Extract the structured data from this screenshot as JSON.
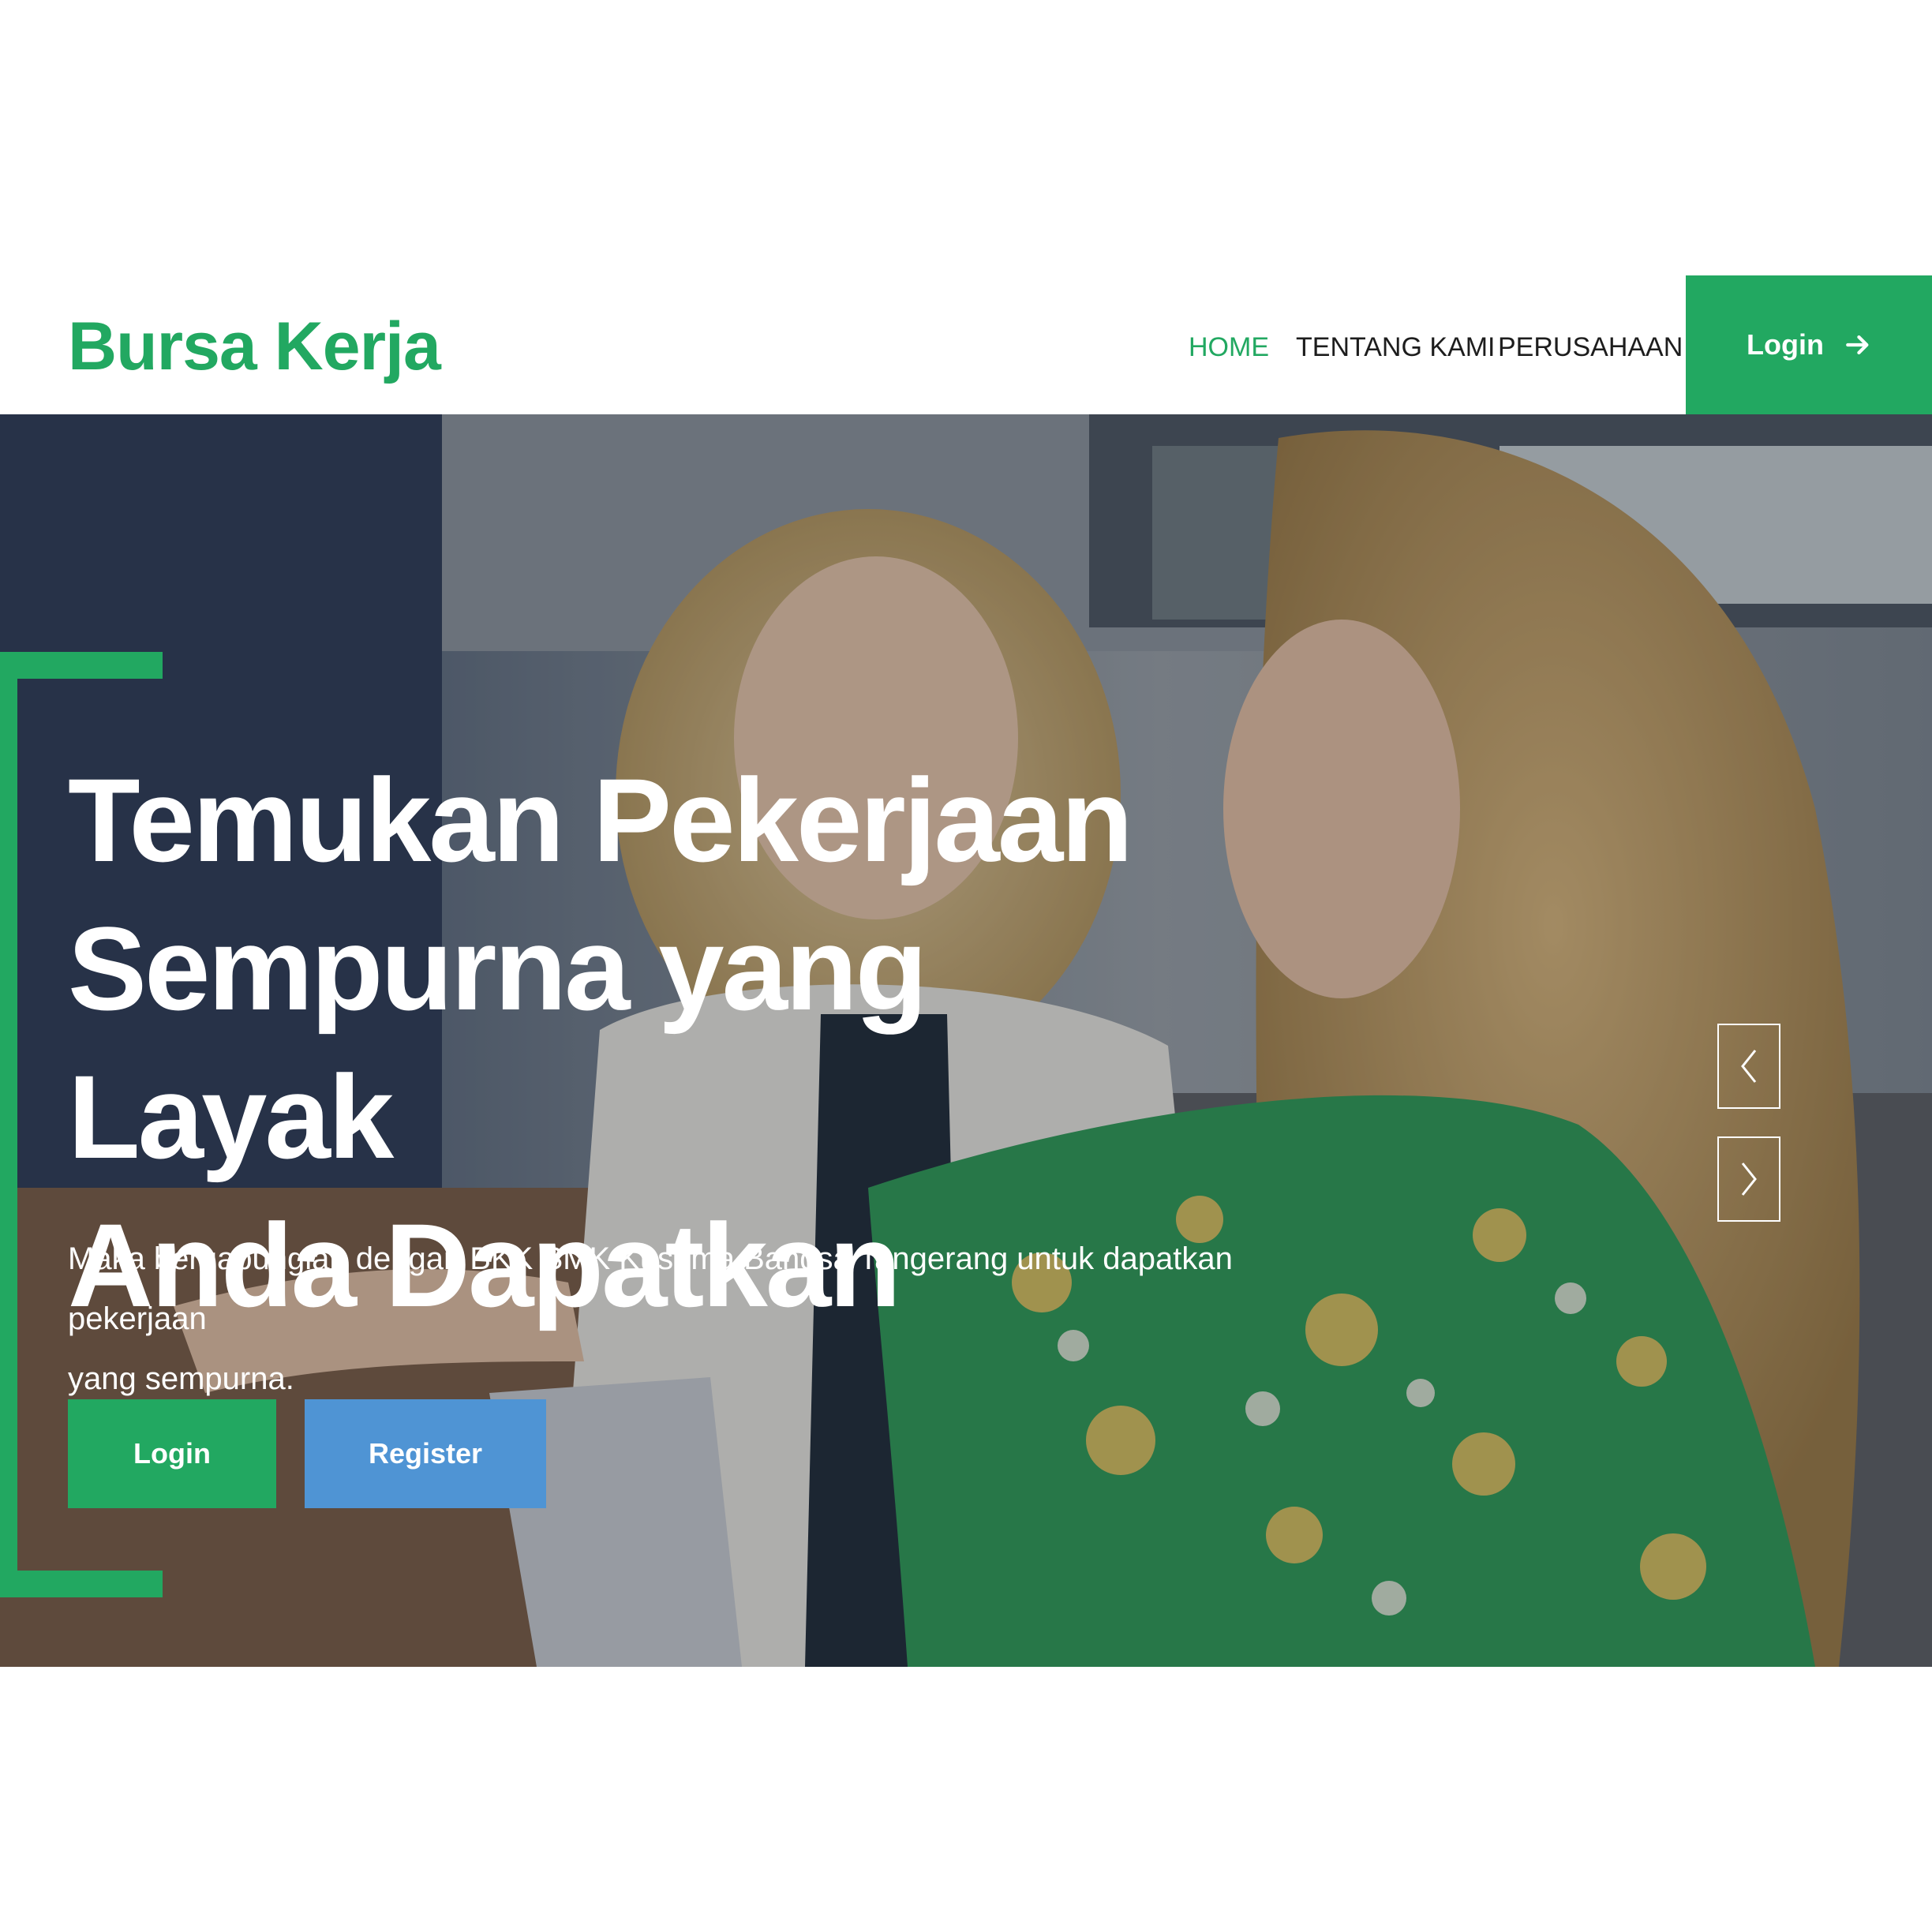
{
  "colors": {
    "accent": "#22a861",
    "register": "#4f94d4",
    "nav_text": "#1d1d1d",
    "white": "#ffffff"
  },
  "header": {
    "brand": "Bursa Kerja",
    "nav": [
      {
        "label": "HOME",
        "active": true
      },
      {
        "label": "TENTANG KAMI",
        "active": false
      },
      {
        "label": "PERUSAHAAN",
        "active": false
      }
    ],
    "login_label": "Login",
    "login_icon": "arrow-right-icon"
  },
  "hero": {
    "title_lines": [
      "Temukan Pekerjaan",
      "Sempurna yang Layak",
      "Anda Dapatkan"
    ],
    "subtitle_lines": [
      "Maka bergabunglah dengan BKK SMK Kusuma Bangsa Tangerang untuk dapatkan pekerjaan",
      "yang sempurna."
    ],
    "buttons": {
      "login": "Login",
      "register": "Register"
    },
    "carousel": {
      "prev_icon": "chevron-left-icon",
      "next_icon": "chevron-right-icon"
    }
  }
}
